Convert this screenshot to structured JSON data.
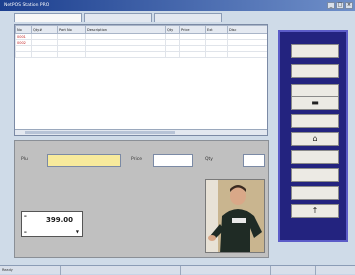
{
  "window": {
    "title": "NetPOS Station PRO"
  },
  "tabs": [
    "",
    "",
    ""
  ],
  "table": {
    "columns": [
      "No",
      "Qty#",
      "Part No",
      "Description",
      "Qty",
      "Price",
      "Ext",
      "Disc"
    ],
    "rows": [
      [
        "0001",
        "",
        "",
        "",
        "",
        "",
        "",
        ""
      ],
      [
        "0002",
        "",
        "",
        "",
        "",
        "",
        "",
        ""
      ],
      [
        "",
        "",
        "",
        "",
        "",
        "",
        "",
        ""
      ],
      [
        "",
        "",
        "",
        "",
        "",
        "",
        "",
        ""
      ]
    ]
  },
  "form": {
    "field1_label": "Plu",
    "field2_label": "Price",
    "field3_label": "Qty"
  },
  "total": {
    "amount": "399.00",
    "arrow": "▼"
  },
  "actions": [
    "",
    "",
    "",
    "",
    "",
    "",
    "",
    "",
    "",
    "",
    "",
    ""
  ],
  "status": [
    "Ready",
    "",
    "",
    "",
    ""
  ]
}
